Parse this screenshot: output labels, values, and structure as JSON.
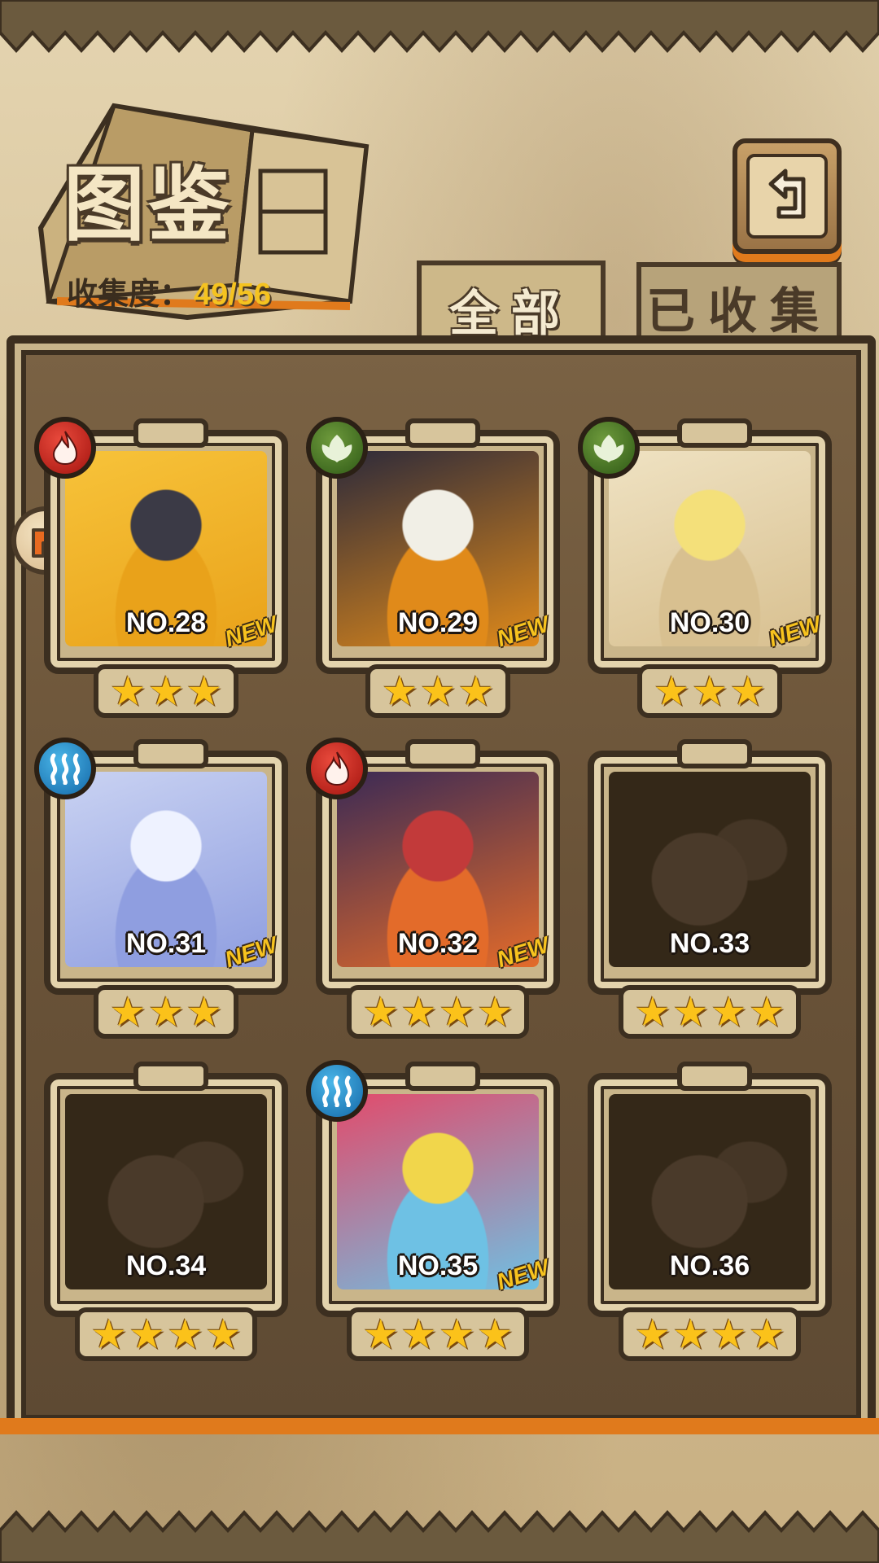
{
  "header": {
    "title": "图鉴",
    "collection_label": "收集度：",
    "collection_value": "49/56"
  },
  "tabs": [
    {
      "label": "全部",
      "active": true
    },
    {
      "label": "已收集",
      "active": false
    }
  ],
  "colors": {
    "accent": "#e07a1c",
    "gold_text": "#f5c320",
    "frame_dark": "#3c2f20",
    "fire": "#c8221a",
    "leaf": "#3f6b1e",
    "water": "#1f86c8"
  },
  "cards": [
    {
      "number": "NO.28",
      "stars": 3,
      "element": "fire",
      "is_new": true,
      "locked": false,
      "new_label": "NEW"
    },
    {
      "number": "NO.29",
      "stars": 3,
      "element": "leaf",
      "is_new": true,
      "locked": false,
      "new_label": "NEW"
    },
    {
      "number": "NO.30",
      "stars": 3,
      "element": "leaf",
      "is_new": true,
      "locked": false,
      "new_label": "NEW"
    },
    {
      "number": "NO.31",
      "stars": 3,
      "element": "water",
      "is_new": true,
      "locked": false,
      "new_label": "NEW"
    },
    {
      "number": "NO.32",
      "stars": 4,
      "element": "fire",
      "is_new": true,
      "locked": false,
      "new_label": "NEW"
    },
    {
      "number": "NO.33",
      "stars": 4,
      "element": "",
      "is_new": false,
      "locked": true,
      "new_label": ""
    },
    {
      "number": "NO.34",
      "stars": 4,
      "element": "",
      "is_new": false,
      "locked": true,
      "new_label": ""
    },
    {
      "number": "NO.35",
      "stars": 4,
      "element": "water",
      "is_new": true,
      "locked": false,
      "new_label": "NEW"
    },
    {
      "number": "NO.36",
      "stars": 4,
      "element": "",
      "is_new": false,
      "locked": true,
      "new_label": ""
    }
  ],
  "icons": {
    "back": "return-arrow-icon",
    "side_badge": "turn-arrow-icon"
  }
}
